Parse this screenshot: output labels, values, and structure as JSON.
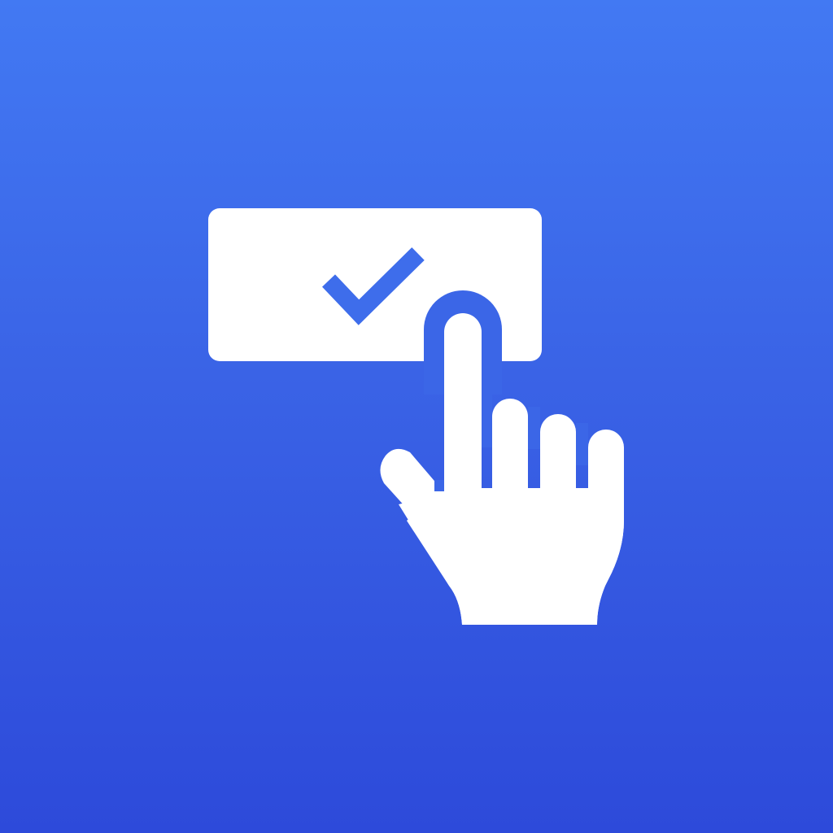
{
  "icon": {
    "name": "tap-to-confirm-icon",
    "parts": [
      "confirm-button-icon",
      "checkmark-icon",
      "pointing-hand-icon"
    ]
  },
  "colors": {
    "background_top": "#4279F3",
    "background_bottom": "#2D4ADA",
    "foreground": "#FFFFFF",
    "checkmark": "#3E6DEB"
  }
}
